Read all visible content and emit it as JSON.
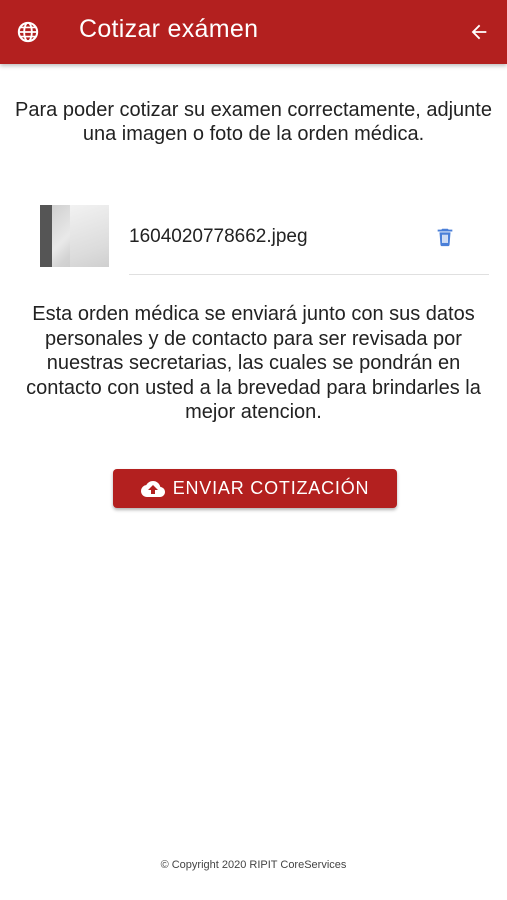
{
  "header": {
    "title": "Cotizar exámen",
    "left_icon": "globe-icon",
    "right_icon": "arrow-back-icon",
    "color": "#b3201f"
  },
  "intro_text": "Para poder cotizar su examen correctamente, adjunte una imagen o foto de la orden médica.",
  "attachment": {
    "filename": "1604020778662.jpeg",
    "delete_icon": "trash-icon",
    "delete_icon_color": "#4a7fd8"
  },
  "info_text": "Esta orden médica se enviará junto con sus datos personales y de contacto para ser revisada por nuestras secretarias, las cuales se pondrán en contacto con usted a la brevedad para brindarles la mejor atencion.",
  "send_button": {
    "label": "ENVIAR COTIZACIÓN",
    "icon": "cloud-upload-icon"
  },
  "footer": "© Copyright 2020 RIPIT CoreServices"
}
